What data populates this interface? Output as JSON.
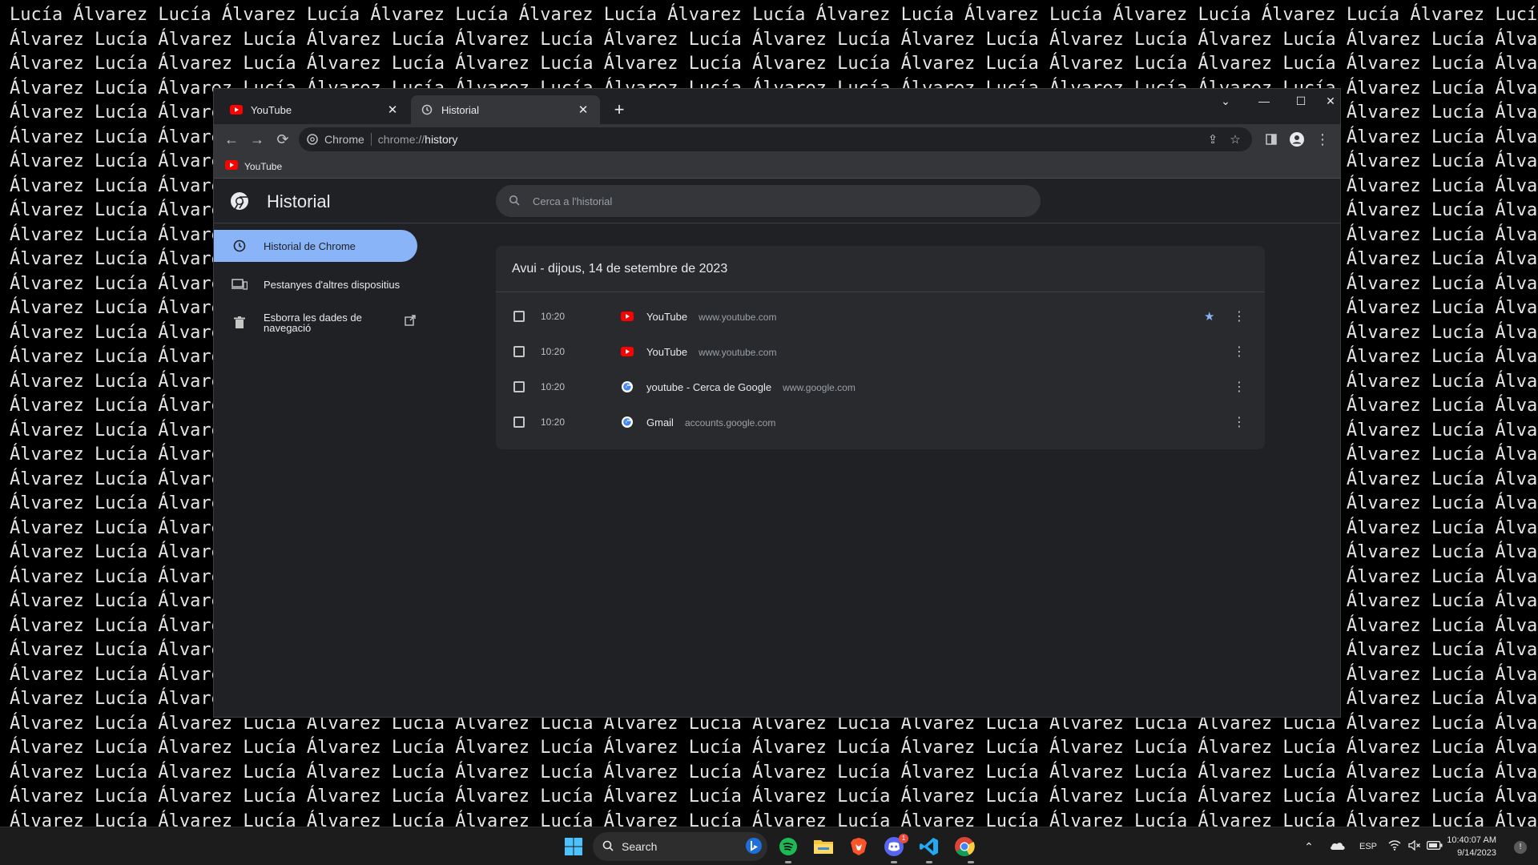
{
  "wallpaper": {
    "word_a": "Lucía",
    "word_b": "Álvarez"
  },
  "browser": {
    "tabs": [
      {
        "title": "YouTube",
        "favicon": "youtube-icon",
        "active": false
      },
      {
        "title": "Historial",
        "favicon": "history-icon",
        "active": true
      }
    ],
    "omnibox": {
      "chip": "Chrome",
      "url_scheme": "chrome://",
      "url_host": "history"
    },
    "bookmarks": [
      {
        "label": "YouTube",
        "favicon": "youtube-icon"
      }
    ]
  },
  "history": {
    "title": "Historial",
    "search_placeholder": "Cerca a l'historial",
    "sidebar": [
      {
        "label": "Historial de Chrome",
        "icon": "clock-icon",
        "selected": true
      },
      {
        "label": "Pestanyes d'altres dispositius",
        "icon": "devices-icon",
        "selected": false
      },
      {
        "label_line1": "Esborra les dades de",
        "label_line2": "navegació",
        "icon": "trash-icon",
        "selected": false
      }
    ],
    "day_heading": "Avui - dijous, 14 de setembre de 2023",
    "entries": [
      {
        "time": "10:20",
        "title": "YouTube",
        "domain": "www.youtube.com",
        "favicon": "youtube-icon",
        "starred": true
      },
      {
        "time": "10:20",
        "title": "YouTube",
        "domain": "www.youtube.com",
        "favicon": "youtube-icon",
        "starred": false
      },
      {
        "time": "10:20",
        "title": "youtube - Cerca de Google",
        "domain": "www.google.com",
        "favicon": "google-icon",
        "starred": false
      },
      {
        "time": "10:20",
        "title": "Gmail",
        "domain": "accounts.google.com",
        "favicon": "google-icon",
        "starred": false
      }
    ]
  },
  "taskbar": {
    "search_label": "Search",
    "discord_badge": "1",
    "language": "ESP",
    "time": "10:40:07 AM",
    "date": "9/14/2023"
  },
  "colors": {
    "accent": "#8ab4f8",
    "background": "#202124",
    "card": "#292a2d",
    "youtube_red": "#ff0000"
  }
}
